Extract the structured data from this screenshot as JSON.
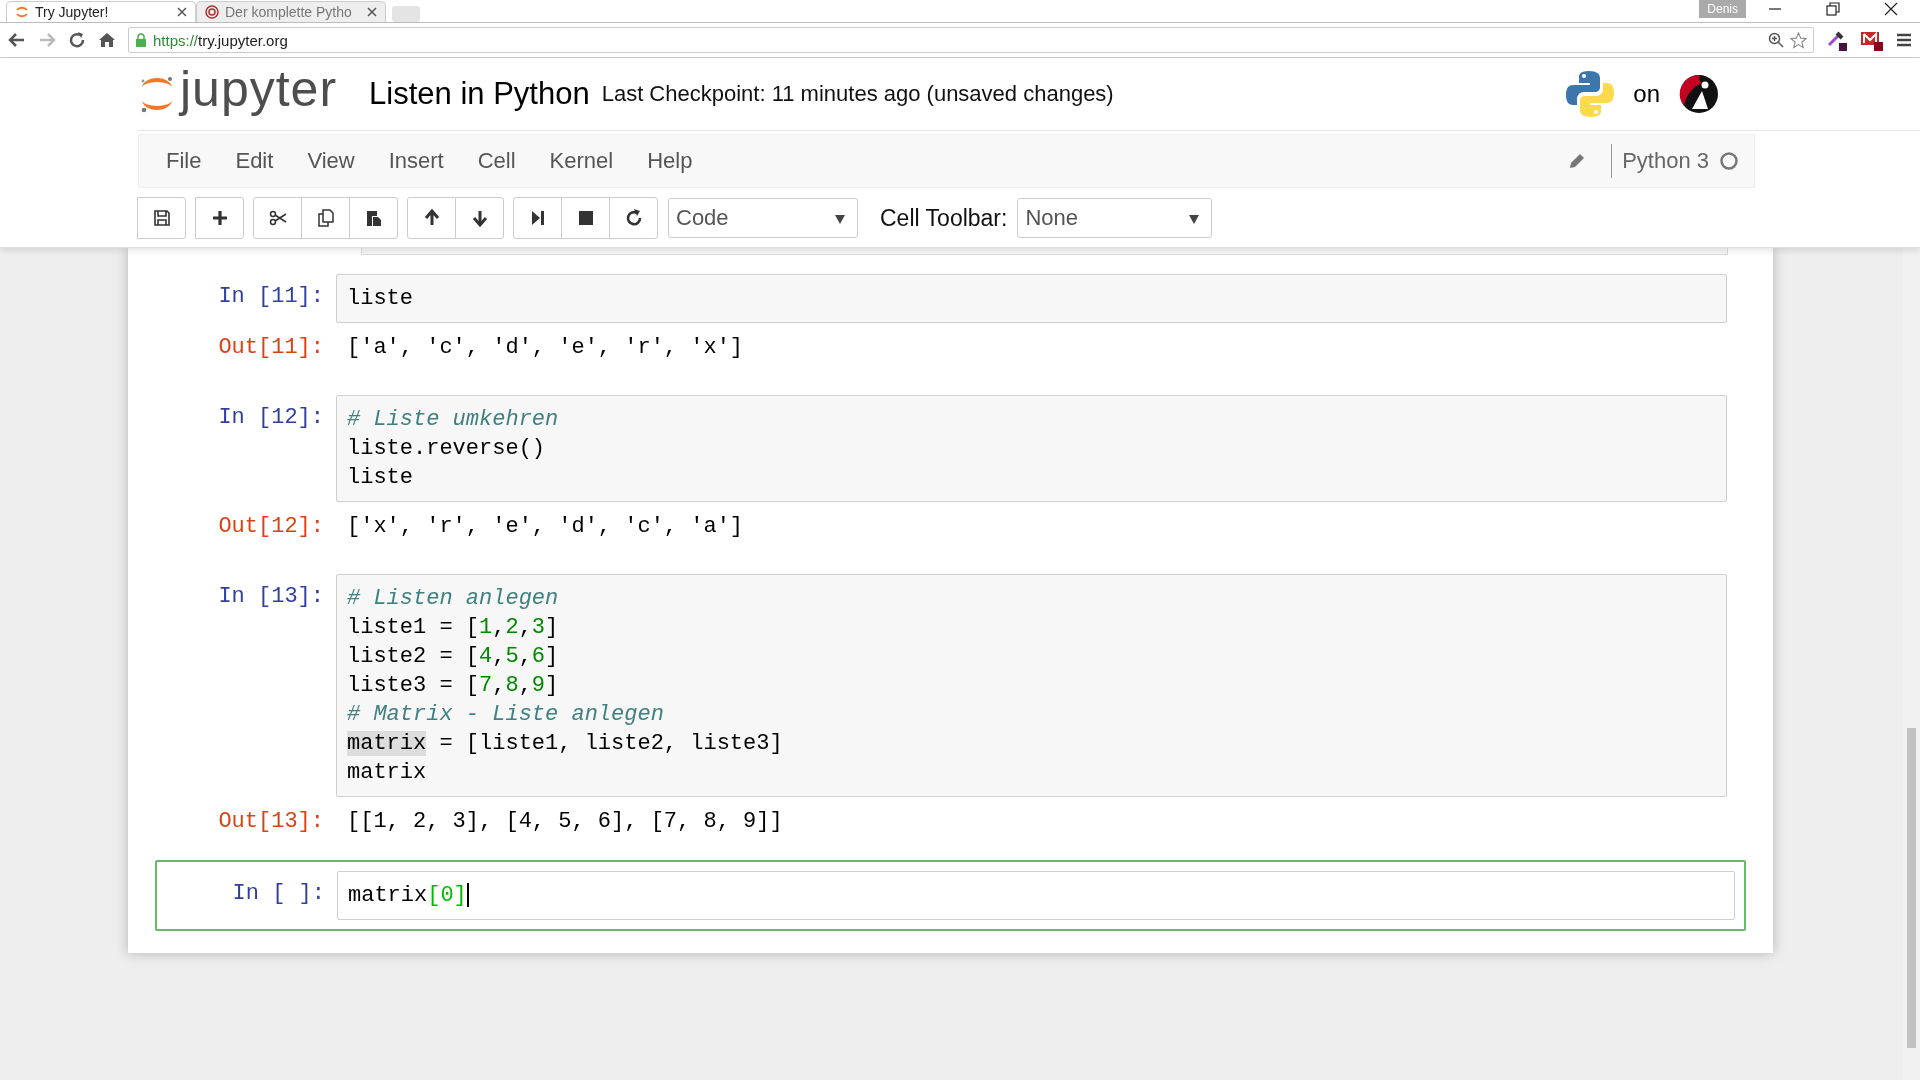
{
  "browser": {
    "tabs": [
      {
        "title": "Try Jupyter!",
        "selected": true
      },
      {
        "title": "Der komplette Pytho",
        "selected": false
      }
    ],
    "profile": "Denis",
    "url_scheme": "https://",
    "url_host": "try.jupyter.org"
  },
  "header": {
    "logo_text": "jupyter",
    "notebook_name": "Listen in Python",
    "checkpoint": "Last Checkpoint: 11 minutes ago (unsaved changes)",
    "on_text": "on"
  },
  "menu": [
    "File",
    "Edit",
    "View",
    "Insert",
    "Cell",
    "Kernel",
    "Help"
  ],
  "kernel": {
    "name": "Python 3",
    "busy": false
  },
  "toolbar": {
    "cell_type": "Code",
    "cell_toolbar_label": "Cell Toolbar:",
    "cell_toolbar_value": "None"
  },
  "cells": [
    {
      "prompt": "In [11]:",
      "selected": false,
      "input": [
        [
          {
            "kind": "plain",
            "text": "liste"
          }
        ]
      ],
      "out_prompt": "Out[11]:",
      "output": "['a', 'c', 'd', 'e', 'r', 'x']"
    },
    {
      "prompt": "In [12]:",
      "selected": false,
      "input": [
        [
          {
            "kind": "comment",
            "text": "# Liste umkehren"
          }
        ],
        [
          {
            "kind": "plain",
            "text": "liste.reverse()"
          }
        ],
        [
          {
            "kind": "plain",
            "text": "liste"
          }
        ]
      ],
      "out_prompt": "Out[12]:",
      "output": "['x', 'r', 'e', 'd', 'c', 'a']"
    },
    {
      "prompt": "In [13]:",
      "selected": false,
      "input": [
        [
          {
            "kind": "comment",
            "text": "# Listen anlegen"
          }
        ],
        [
          {
            "kind": "plain",
            "text": "liste1 = ["
          },
          {
            "kind": "number",
            "text": "1"
          },
          {
            "kind": "plain",
            "text": ","
          },
          {
            "kind": "number",
            "text": "2"
          },
          {
            "kind": "plain",
            "text": ","
          },
          {
            "kind": "number",
            "text": "3"
          },
          {
            "kind": "plain",
            "text": "]"
          }
        ],
        [
          {
            "kind": "plain",
            "text": "liste2 = ["
          },
          {
            "kind": "number",
            "text": "4"
          },
          {
            "kind": "plain",
            "text": ","
          },
          {
            "kind": "number",
            "text": "5"
          },
          {
            "kind": "plain",
            "text": ","
          },
          {
            "kind": "number",
            "text": "6"
          },
          {
            "kind": "plain",
            "text": "]"
          }
        ],
        [
          {
            "kind": "plain",
            "text": "liste3 = ["
          },
          {
            "kind": "number",
            "text": "7"
          },
          {
            "kind": "plain",
            "text": ","
          },
          {
            "kind": "number",
            "text": "8"
          },
          {
            "kind": "plain",
            "text": ","
          },
          {
            "kind": "number",
            "text": "9"
          },
          {
            "kind": "plain",
            "text": "]"
          }
        ],
        [
          {
            "kind": "comment",
            "text": "# Matrix - Liste anlegen"
          }
        ],
        [
          {
            "kind": "highlight",
            "text": "matrix"
          },
          {
            "kind": "plain",
            "text": " = [liste1, liste2, liste3]"
          }
        ],
        [
          {
            "kind": "plain",
            "text": "matrix"
          }
        ]
      ],
      "out_prompt": "Out[13]:",
      "output": "[[1, 2, 3], [4, 5, 6], [7, 8, 9]]"
    },
    {
      "prompt": "In [ ]:",
      "selected": true,
      "input": [
        [
          {
            "kind": "plain",
            "text": "matrix"
          },
          {
            "kind": "match",
            "text": "[0]"
          }
        ]
      ]
    }
  ]
}
